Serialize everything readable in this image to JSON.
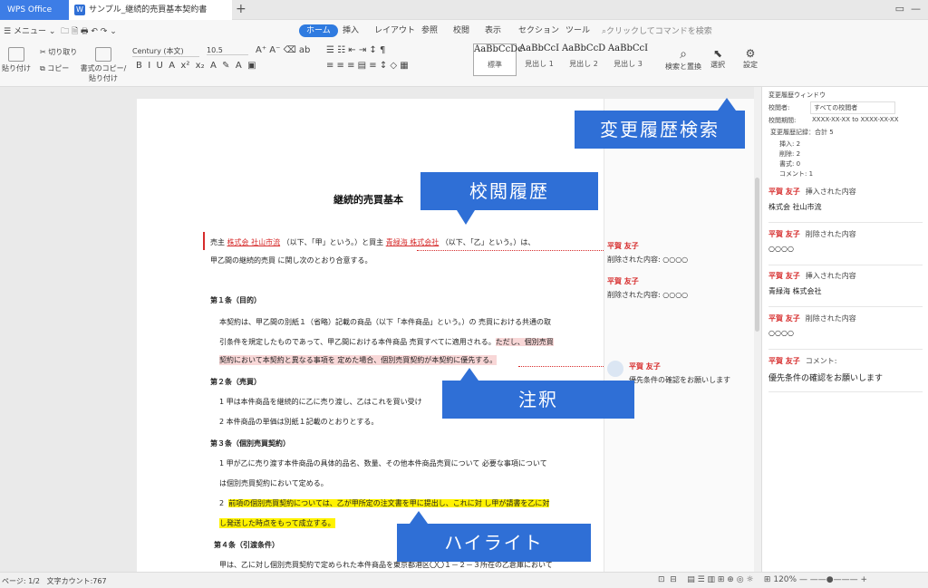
{
  "tabs": {
    "app": "WPS Office",
    "doc": "サンプル_継続的売買基本契約書"
  },
  "menu": {
    "menu_label": "メニュー",
    "ribbon": [
      "ホーム",
      "挿入",
      "レイアウト",
      "参照",
      "校閲",
      "表示",
      "セクション",
      "ツール"
    ],
    "active": "ホーム",
    "search_placeholder": "クリックしてコマンドを検索"
  },
  "toolbar": {
    "paste": "貼り付け",
    "cut": "切り取り",
    "copy": "コピー",
    "format_painter": "書式のコピー/貼り付け",
    "font": "Century (本文)",
    "size": "10.5",
    "styles": [
      {
        "preview": "AaBbCcDc",
        "label": "標準"
      },
      {
        "preview": "AaBbCcI",
        "label": "見出し 1"
      },
      {
        "preview": "AaBbCcD",
        "label": "見出し 2"
      },
      {
        "preview": "AaBbCcI",
        "label": "見出し 3"
      }
    ],
    "find_replace": "検索と置換",
    "select": "選択",
    "settings": "設定"
  },
  "doc": {
    "title": "継続的売買基本",
    "p1_a": "売主",
    "p1_ins1": "株式会 社山市流",
    "p1_b": "（以下、「甲」という。）と買主",
    "p1_ins2": "青緑海 株式会社",
    "p1_c": "（以下、「乙」という。）は、",
    "p1_d": "甲乙間の継続的売買 に関し次のとおり合意する。",
    "a1": "第１条（目的）",
    "a1_l1": "本契約は、甲乙間の別紙１（省略）記載の商品（以下「本件商品」という。）の 売買における共通の取",
    "a1_l2a": "引条件を規定したものであって、甲乙間における本件商品 売買すべてに適用される。",
    "a1_l2b": "ただし、個別売買",
    "a1_l3": "契約において本契約と異なる事項を 定めた場合、個別売買契約が本契約に優先する。",
    "a2": "第２条（売買）",
    "a2_l1": "1  甲は本件商品を継続的に乙に売り渡し、乙はこれを買い受け",
    "a2_l2": "2  本件商品の単価は別紙１記載のとおりとする。",
    "a3": "第３条（個別売買契約）",
    "a3_l1": "1  甲が乙に売り渡す本件商品の具体的品名、数量、その他本件商品売買について 必要な事項について",
    "a3_l2": "は個別売買契約において定める。",
    "a3_l3a": "2",
    "a3_l3b": "前項の個別売買契約については、乙が甲所定の注文書を甲に提出し、これに対 し甲が請書を乙に対",
    "a3_l4": "し発送した時点をもって成立する。",
    "a4": "第４条（引渡条件）",
    "a4_l1": "甲は、乙に対し個別売買契約で定められた本件商品を東京都港区〇〇１－２－３所在の乙倉庫において"
  },
  "margin": [
    {
      "name": "平賀 友子",
      "text": "削除された内容: ○○○○"
    },
    {
      "name": "平賀 友子",
      "text": "削除された内容: ○○○○"
    },
    {
      "name": "平賀 友子",
      "text": "優先条件の確認をお願いします"
    }
  ],
  "callouts": {
    "history": "校閲履歴",
    "history_search": "変更履歴検索",
    "comment": "注釈",
    "highlight": "ハイライト"
  },
  "panel": {
    "title": "変更履歴ウィンドウ",
    "reviewer_label": "校閲者:",
    "reviewer_value": "すべての校閲者",
    "period_label": "校閲期間:",
    "period_value": "XXXX-XX-XX to XXXX-XX-XX",
    "records": "変更履歴記録：合計 5",
    "counts": [
      "挿入: 2",
      "削除: 2",
      "書式: 0",
      "コメント: 1"
    ],
    "entries": [
      {
        "name": "平賀 友子",
        "action": "挿入された内容",
        "body": "株式会 社山市流"
      },
      {
        "name": "平賀 友子",
        "action": "削除された内容",
        "body": "○○○○"
      },
      {
        "name": "平賀 友子",
        "action": "挿入された内容",
        "body": "青緑海 株式会社"
      },
      {
        "name": "平賀 友子",
        "action": "削除された内容",
        "body": "○○○○"
      },
      {
        "name": "平賀 友子",
        "action": "コメント:",
        "body": "優先条件の確認をお願いします"
      }
    ]
  },
  "status": {
    "page": "ページ: 1/2",
    "words": "文字カウント:767",
    "zoom": "120%"
  }
}
